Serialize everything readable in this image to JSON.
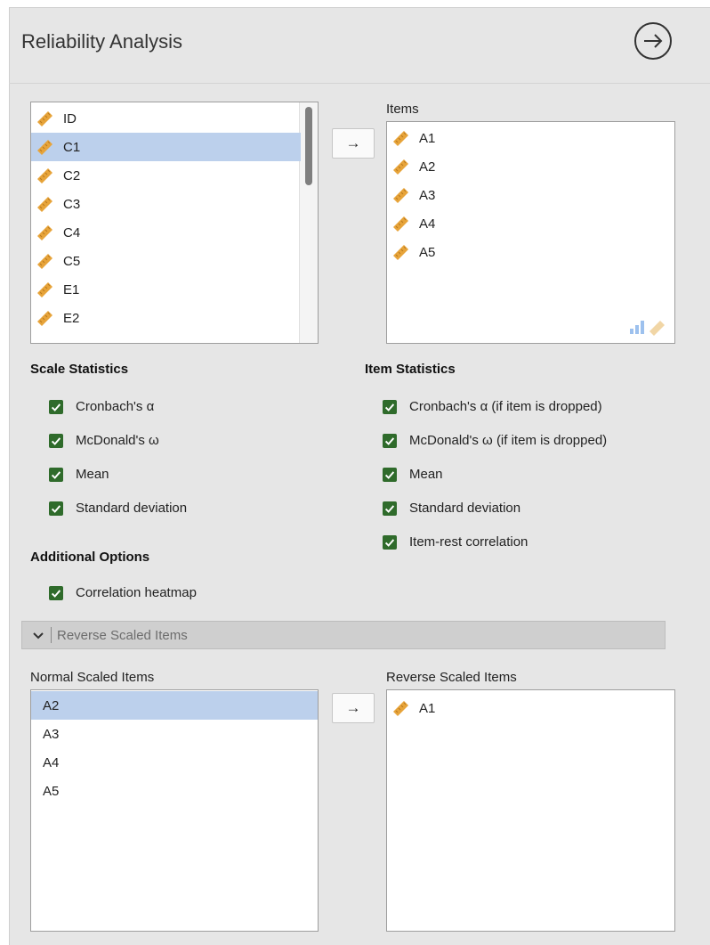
{
  "header": {
    "title": "Reliability Analysis",
    "run_icon": "arrow-circle-right-icon"
  },
  "colors": {
    "panel_bg": "#e6e6e6",
    "selected_row": "#bcd0ec",
    "checkbox_green": "#2f6b2b",
    "ruler": "#e7a43a"
  },
  "variables": {
    "items": [
      {
        "label": "ID",
        "selected": false
      },
      {
        "label": "C1",
        "selected": true
      },
      {
        "label": "C2",
        "selected": false
      },
      {
        "label": "C3",
        "selected": false
      },
      {
        "label": "C4",
        "selected": false
      },
      {
        "label": "C5",
        "selected": false
      },
      {
        "label": "E1",
        "selected": false
      },
      {
        "label": "E2",
        "selected": false
      }
    ]
  },
  "move_button": {
    "symbol": "→"
  },
  "items_box": {
    "label": "Items",
    "items": [
      {
        "label": "A1"
      },
      {
        "label": "A2"
      },
      {
        "label": "A3"
      },
      {
        "label": "A4"
      },
      {
        "label": "A5"
      }
    ]
  },
  "scale_statistics": {
    "title": "Scale Statistics",
    "options": [
      {
        "label": "Cronbach's α",
        "checked": true
      },
      {
        "label": "McDonald's ω",
        "checked": true
      },
      {
        "label": "Mean",
        "checked": true
      },
      {
        "label": "Standard deviation",
        "checked": true
      }
    ]
  },
  "item_statistics": {
    "title": "Item Statistics",
    "options": [
      {
        "label": "Cronbach's α (if item is dropped)",
        "checked": true
      },
      {
        "label": "McDonald's ω (if item is dropped)",
        "checked": true
      },
      {
        "label": "Mean",
        "checked": true
      },
      {
        "label": "Standard deviation",
        "checked": true
      },
      {
        "label": "Item-rest correlation",
        "checked": true
      }
    ]
  },
  "additional_options": {
    "title": "Additional Options",
    "options": [
      {
        "label": "Correlation heatmap",
        "checked": true
      }
    ]
  },
  "reverse_section": {
    "title": "Reverse Scaled Items",
    "normal_label": "Normal Scaled Items",
    "reverse_label": "Reverse Scaled Items",
    "normal_items": [
      {
        "label": "A2",
        "selected": true
      },
      {
        "label": "A3",
        "selected": false
      },
      {
        "label": "A4",
        "selected": false
      },
      {
        "label": "A5",
        "selected": false
      }
    ],
    "reverse_items": [
      {
        "label": "A1"
      }
    ]
  }
}
